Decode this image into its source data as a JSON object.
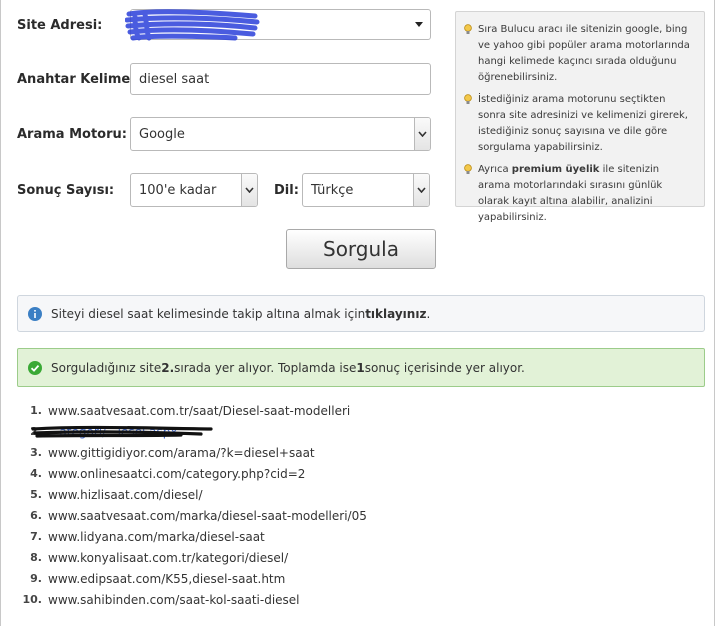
{
  "form": {
    "site_label": "Site Adresi:",
    "keyword_label": "Anahtar Kelime:",
    "keyword_value": "diesel saat",
    "engine_label": "Arama Motoru:",
    "engine_value": "Google",
    "count_label": "Sonuç Sayısı:",
    "count_value": "100'e kadar",
    "lang_label": "Dil:",
    "lang_value": "Türkçe"
  },
  "submit_label": "Sorgula",
  "tips": [
    "Sıra Bulucu aracı ile sitenizin google, bing ve yahoo gibi popüler arama motorlarında hangi kelimede kaçıncı sırada olduğunu öğrenebilirsiniz.",
    "İstediğiniz arama motorunu seçtikten sonra site adresinizi ve kelimenizi girerek, istediğiniz sonuç sayısına ve dile göre sorgulama yapabilirsiniz."
  ],
  "tip3": {
    "pre": "Ayrıca ",
    "bold": "premium üyelik",
    "post": " ile sitenizin arama motorlarındaki sırasını günlük olarak kayıt altına alabilir, analizini yapabilirsiniz."
  },
  "info": {
    "pre": "Siteyi diesel saat kelimesinde takip altına almak için ",
    "link": "tıklayınız",
    "post": "."
  },
  "success": {
    "p1": "Sorguladığınız site ",
    "rank": "2.",
    "p2": " sırada yer alıyor. Toplamda ise ",
    "total": "1",
    "p3": " sonuç içerisinde yer alıyor."
  },
  "results": [
    {
      "num": "1.",
      "url": "www.saatvesaat.com.tr/saat/Diesel-saat-modelleri"
    },
    {
      "num": "2.",
      "url": "...ategori/...iesel.aspx"
    },
    {
      "num": "3.",
      "url": "www.gittigidiyor.com/arama/?k=diesel+saat"
    },
    {
      "num": "4.",
      "url": "www.onlinesaatci.com/category.php?cid=2"
    },
    {
      "num": "5.",
      "url": "www.hizlisaat.com/diesel/"
    },
    {
      "num": "6.",
      "url": "www.saatvesaat.com/marka/diesel-saat-modelleri/05"
    },
    {
      "num": "7.",
      "url": "www.lidyana.com/marka/diesel-saat"
    },
    {
      "num": "8.",
      "url": "www.konyalisaat.com.tr/kategori/diesel/"
    },
    {
      "num": "9.",
      "url": "www.edipsaat.com/K55,diesel-saat.htm"
    },
    {
      "num": "10.",
      "url": "www.sahibinden.com/saat-kol-saati-diesel"
    }
  ],
  "colors": {
    "info_icon": "#3b7fc4",
    "success_icon": "#3aa935",
    "tip_icon": "#e0b12a",
    "scribble": "#2a3fd9"
  }
}
